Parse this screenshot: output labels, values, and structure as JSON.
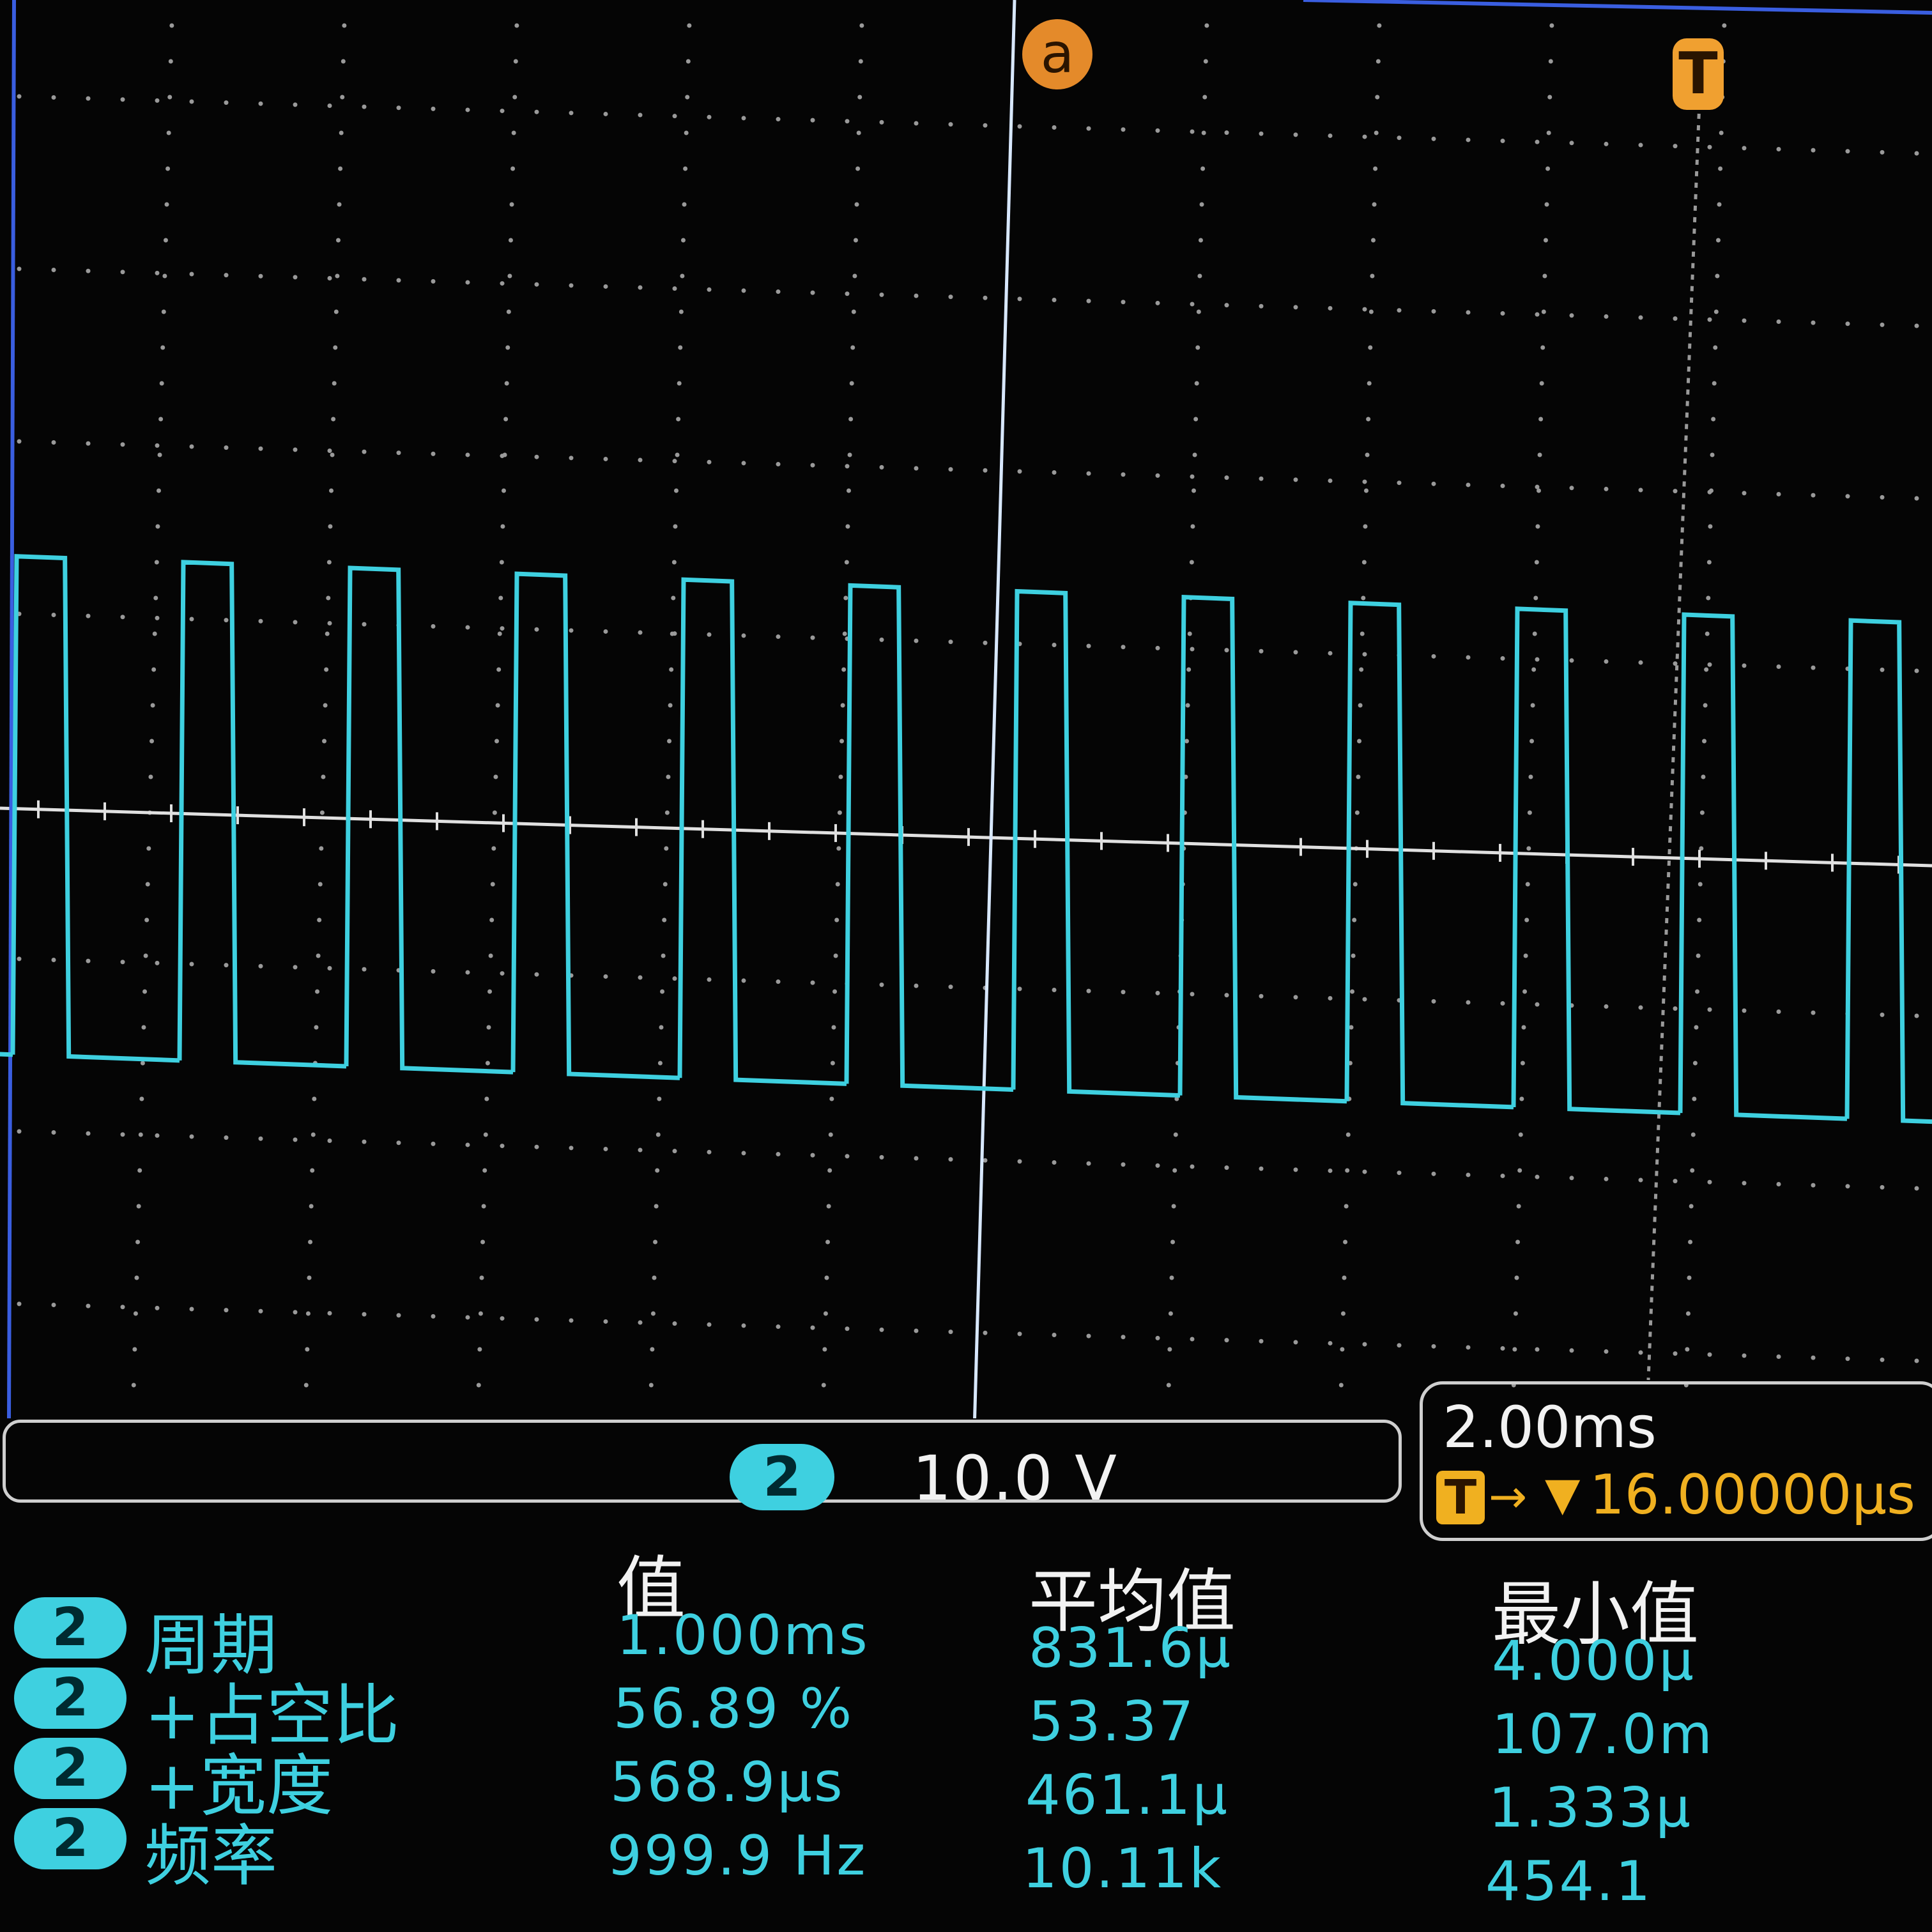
{
  "cursor": {
    "label": "a"
  },
  "trigger_marker": {
    "label": "T"
  },
  "channel_scale": {
    "channel": "2",
    "volts_per_div": "10.0 V"
  },
  "horizontal": {
    "timebase": "2.00ms",
    "trigger_icon": "T",
    "trigger_arrow": "→",
    "trigger_slope": "▼",
    "trigger_offset": "16.00000μs"
  },
  "measurements": {
    "headers": [
      "值",
      "平均值",
      "最小值"
    ],
    "rows": [
      {
        "channel": "2",
        "label": "周期",
        "value": "1.000ms",
        "mean": "831.6μ",
        "min": "4.000μ"
      },
      {
        "channel": "2",
        "label": "+占空比",
        "value": "56.89 %",
        "mean": "53.37",
        "min": "107.0m"
      },
      {
        "channel": "2",
        "label": "+宽度",
        "value": "568.9μs",
        "mean": "461.1μ",
        "min": "1.333μ"
      },
      {
        "channel": "2",
        "label": "频率",
        "value": "999.9 Hz",
        "mean": "10.11k",
        "min": "454.1"
      }
    ]
  },
  "colors": {
    "trace": "#3ed0e0",
    "trigger": "#f0b020",
    "grid": "#9a9a9a",
    "background": "#050505"
  }
}
